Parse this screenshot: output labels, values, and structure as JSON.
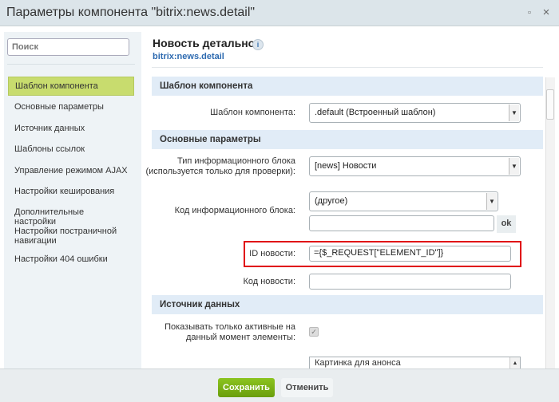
{
  "window": {
    "title": "Параметры компонента \"bitrix:news.detail\"",
    "expand_icon": "▫",
    "close_icon": "×"
  },
  "sidebar": {
    "search_placeholder": "Поиск",
    "items": [
      {
        "label": "Шаблон компонента",
        "active": true
      },
      {
        "label": "Основные параметры"
      },
      {
        "label": "Источник данных"
      },
      {
        "label": "Шаблоны ссылок"
      },
      {
        "label": "Управление режимом AJAX"
      },
      {
        "label": "Настройки кеширования"
      },
      {
        "label": "Дополнительные настройки"
      },
      {
        "label": "Настройки постраничной навигации"
      },
      {
        "label": "Настройки 404 ошибки"
      }
    ]
  },
  "main": {
    "title": "Новость детально",
    "info_icon": "i",
    "component": "bitrix:news.detail",
    "sections": {
      "template": "Шаблон компонента",
      "basic": "Основные параметры",
      "source": "Источник данных"
    },
    "fields": {
      "template": {
        "label": "Шаблон компонента:",
        "value": ".default (Встроенный шаблон)"
      },
      "iblock_type": {
        "label1": "Тип информационного блока",
        "label2": "(используется только для проверки):",
        "value": "[news] Новости"
      },
      "iblock_id": {
        "label": "Код информационного блока:",
        "value": "(другое)",
        "input": "",
        "ok": "ok"
      },
      "element_id": {
        "label": "ID новости:",
        "value": "={$_REQUEST[\"ELEMENT_ID\"]}"
      },
      "element_code": {
        "label": "Код новости:",
        "value": ""
      },
      "active_only": {
        "label1": "Показывать только активные на",
        "label2": "данный момент элементы:",
        "checked": true
      },
      "fields_list": {
        "first_option": "Картинка для анонса"
      }
    }
  },
  "footer": {
    "save": "Сохранить",
    "cancel": "Отменить"
  }
}
